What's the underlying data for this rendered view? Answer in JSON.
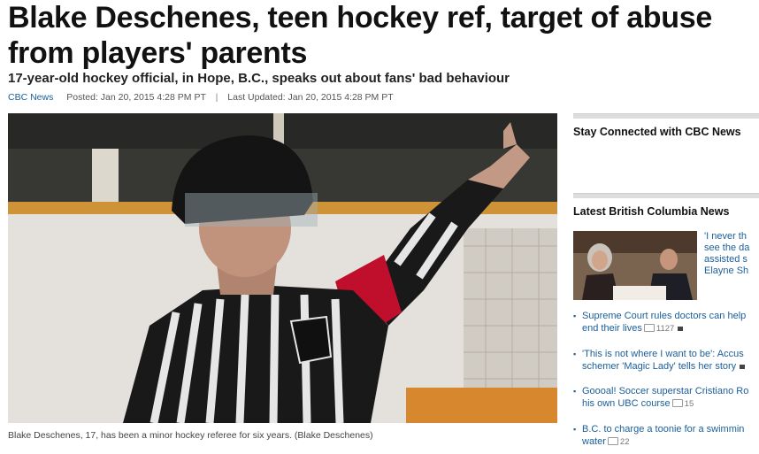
{
  "article": {
    "headline": "Blake Deschenes, teen hockey ref, target of abuse from players' parents",
    "subheadline": "17-year-old hockey official, in Hope, B.C., speaks out about fans' bad behaviour",
    "source": "CBC News",
    "posted": "Posted: Jan 20, 2015 4:28 PM PT",
    "separator": "|",
    "updated": "Last Updated: Jan 20, 2015 4:28 PM PT",
    "caption": "Blake Deschenes, 17, has been a minor hockey referee for six years. (Blake Deschenes)"
  },
  "sidebar": {
    "stay_connected_title": "Stay Connected with CBC News",
    "latest_title": "Latest British Columbia News",
    "feature_lines": [
      "'I never th",
      "see the da",
      "assisted s",
      "Elayne Sh"
    ],
    "items": [
      {
        "line1": "Supreme Court rules doctors can help",
        "line2": "end their lives",
        "comments": "1127",
        "video": true
      },
      {
        "line1": "'This is not where I want to be': Accus",
        "line2": "schemer 'Magic Lady' tells her story",
        "comments": "",
        "video": false
      },
      {
        "line1": "Goooal! Soccer superstar Cristiano Ro",
        "line2": "his own UBC course",
        "comments": "15",
        "video": false
      },
      {
        "line1": "B.C. to charge a toonie for a swimmin",
        "line2": "water",
        "comments": "22",
        "video": false
      }
    ]
  },
  "colors": {
    "link": "#1a5e9a",
    "armband": "#c8102e"
  }
}
